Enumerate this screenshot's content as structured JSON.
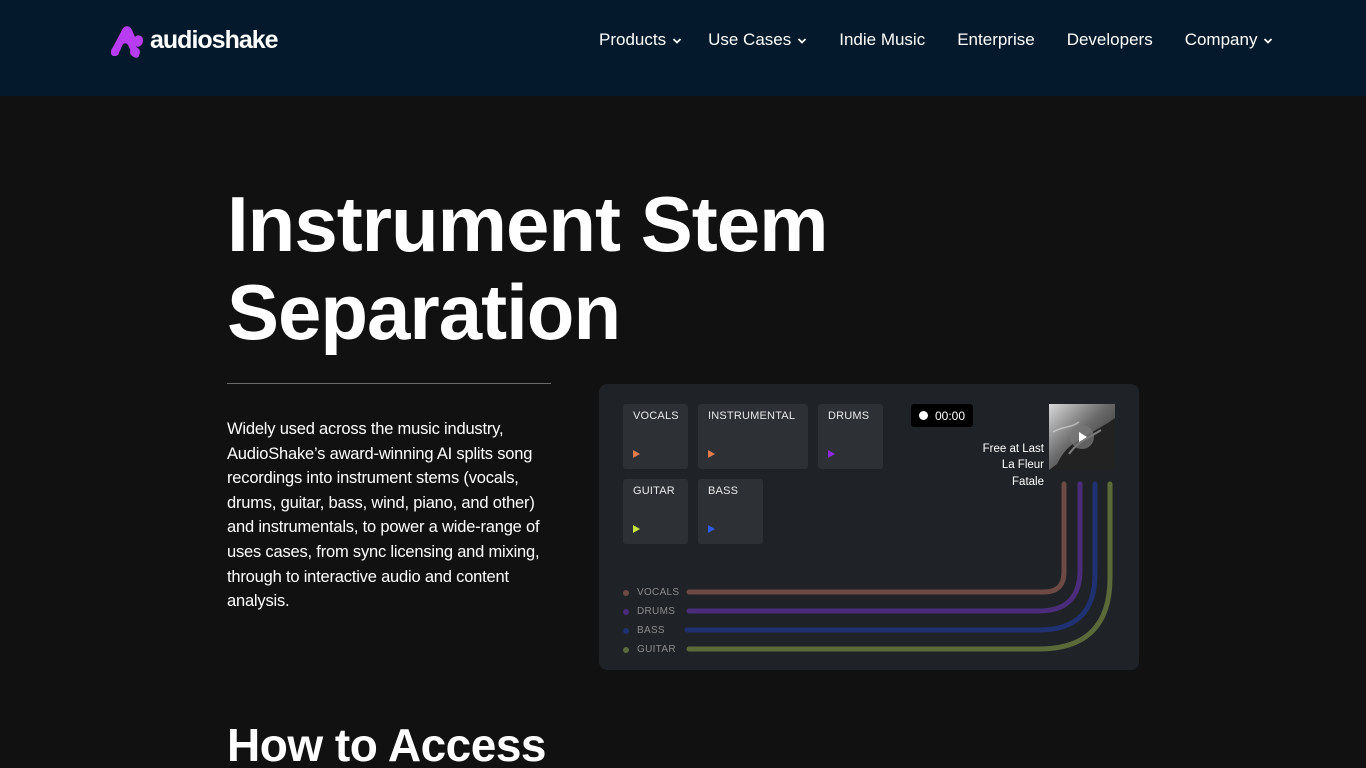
{
  "header": {
    "logo_text": "audioshake",
    "nav": [
      {
        "label": "Products",
        "dropdown": true
      },
      {
        "label": "Use Cases",
        "dropdown": true
      },
      {
        "label": "Indie Music",
        "dropdown": false
      },
      {
        "label": "Enterprise",
        "dropdown": false
      },
      {
        "label": "Developers",
        "dropdown": false
      },
      {
        "label": "Company",
        "dropdown": true
      }
    ]
  },
  "hero": {
    "title_line1": "Instrument Stem",
    "title_line2": "Separation",
    "description": "Widely used across the music industry, AudioShake’s award-winning AI splits song recordings into instrument stems (vocals, drums, guitar, bass, wind, piano, and other) and instrumentals, to power a wide-range of uses cases, from sync licensing and mixing, through to interactive audio and content analysis."
  },
  "demo": {
    "stems": [
      {
        "label": "VOCALS",
        "play_color": "#e07b4d"
      },
      {
        "label": "INSTRUMENTAL",
        "play_color": "#e07b4d"
      },
      {
        "label": "DRUMS",
        "play_color": "#8a2be2"
      },
      {
        "label": "GUITAR",
        "play_color": "#c8e63c"
      },
      {
        "label": "BASS",
        "play_color": "#2f5bea"
      }
    ],
    "timer": "00:00",
    "track": {
      "title": "Free at Last",
      "artist_line1": "La Fleur",
      "artist_line2": "Fatale"
    },
    "legend": [
      {
        "label": "VOCALS",
        "color": "#6e4a44"
      },
      {
        "label": "DRUMS",
        "color": "#4a2c7a"
      },
      {
        "label": "BASS",
        "color": "#1f3170"
      },
      {
        "label": "GUITAR",
        "color": "#5c6a3a"
      }
    ]
  },
  "next_section": {
    "title": "How to Access"
  },
  "colors": {
    "header_bg": "#04192b",
    "page_bg": "#111111",
    "panel_bg": "#1f2226",
    "brand": "#b83df2"
  }
}
